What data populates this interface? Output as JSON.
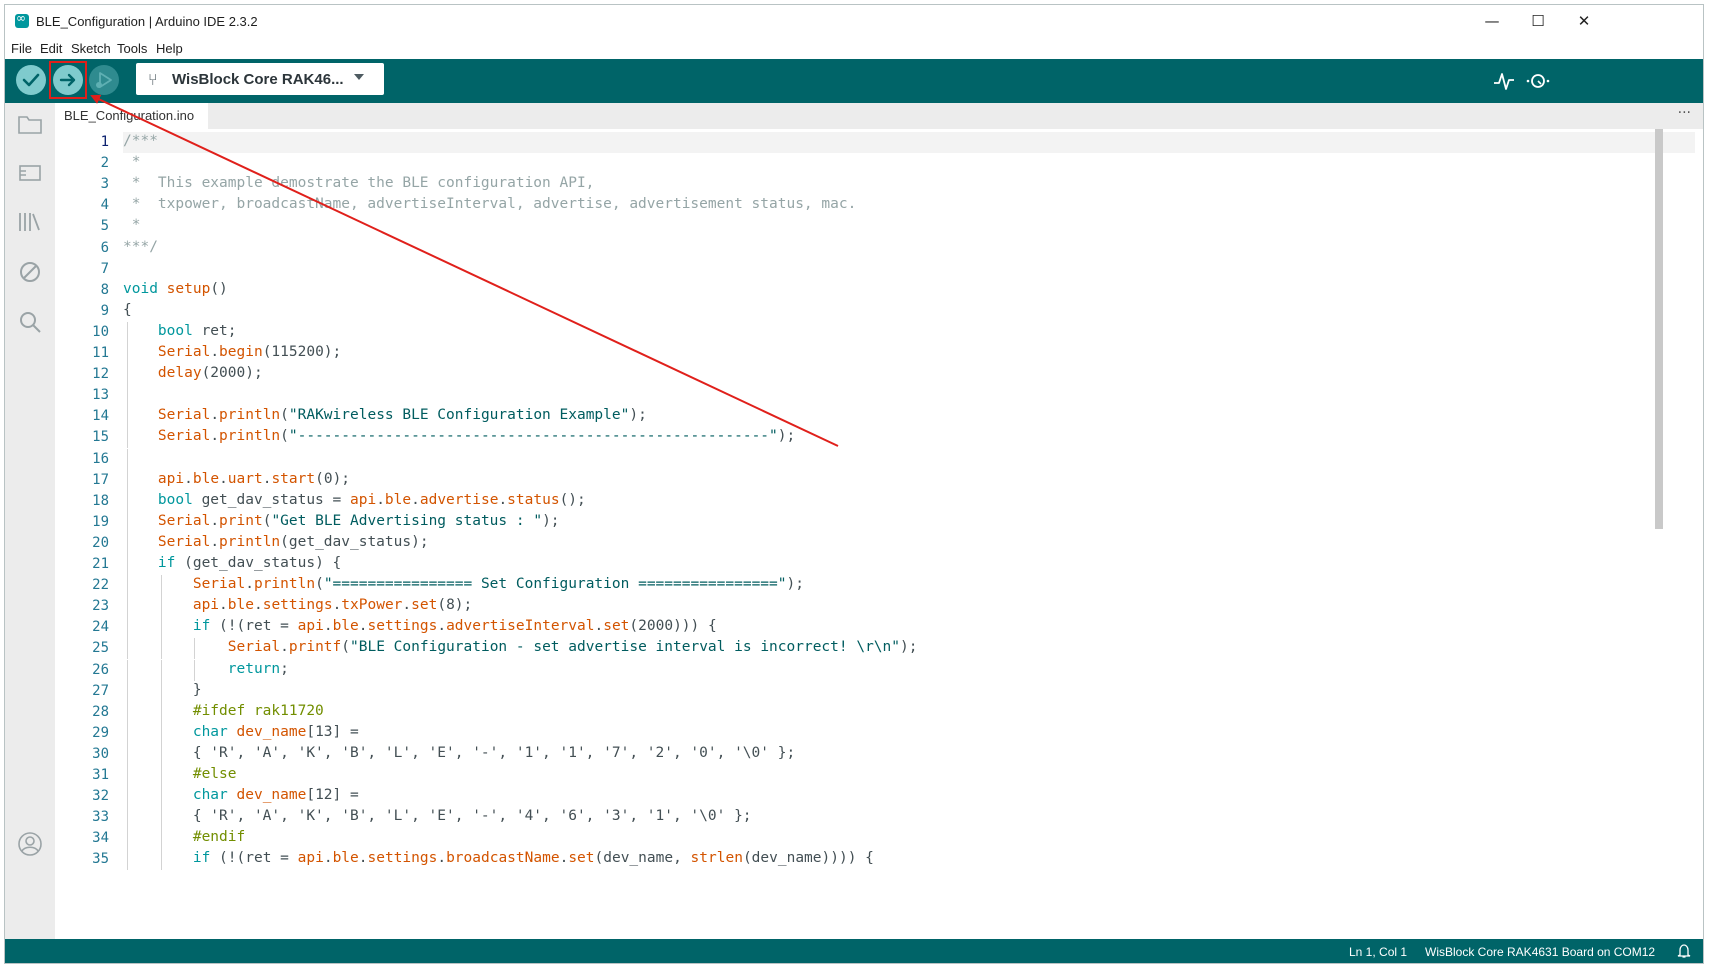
{
  "window": {
    "title": "BLE_Configuration | Arduino IDE 2.3.2"
  },
  "window_controls": {
    "minimize": "—",
    "maximize": "☐",
    "close": "✕"
  },
  "menu": [
    "File",
    "Edit",
    "Sketch",
    "Tools",
    "Help"
  ],
  "toolbar": {
    "verify_icon": "checkmark-icon",
    "upload_icon": "arrow-right-icon",
    "debug_icon": "debug-play-icon",
    "board": "WisBlock Core RAK46...",
    "serial_plotter_icon": "pulse-icon",
    "serial_monitor_icon": "magnifier-dots-icon"
  },
  "sidebar": [
    "folder-icon",
    "boards-icon",
    "library-icon",
    "debug-disabled-icon",
    "search-icon",
    "account-icon"
  ],
  "tab": {
    "label": "BLE_Configuration.ino",
    "more": "···"
  },
  "editor": {
    "active_line": 1,
    "line_numbers": [
      "1",
      "2",
      "3",
      "4",
      "5",
      "6",
      "7",
      "8",
      "9",
      "10",
      "11",
      "12",
      "13",
      "14",
      "15",
      "16",
      "17",
      "18",
      "19",
      "20",
      "21",
      "22",
      "23",
      "24",
      "25",
      "26",
      "27",
      "28",
      "29",
      "30",
      "31",
      "32",
      "33",
      "34",
      "35"
    ],
    "lines": [
      [
        [
          "/***",
          "cm"
        ]
      ],
      [
        [
          " *",
          "cm"
        ]
      ],
      [
        [
          " *  This example demostrate the BLE configuration API,",
          "cm"
        ]
      ],
      [
        [
          " *  txpower, broadcastName, advertiseInterval, advertise, advertisement status, mac.",
          "cm"
        ]
      ],
      [
        [
          " *",
          "cm"
        ]
      ],
      [
        [
          "***/",
          "cm"
        ]
      ],
      [],
      [
        [
          "void",
          "kw"
        ],
        [
          " ",
          "tx"
        ],
        [
          "setup",
          "fn"
        ],
        [
          "()",
          "tx"
        ]
      ],
      [
        [
          "{",
          "tx"
        ]
      ],
      [
        [
          "    ",
          "tx"
        ],
        [
          "bool",
          "kw"
        ],
        [
          " ret;",
          "tx"
        ]
      ],
      [
        [
          "    ",
          "tx"
        ],
        [
          "Serial",
          "fn"
        ],
        [
          ".",
          "tx"
        ],
        [
          "begin",
          "fn"
        ],
        [
          "(115200);",
          "tx"
        ]
      ],
      [
        [
          "    ",
          "tx"
        ],
        [
          "delay",
          "fn"
        ],
        [
          "(2000);",
          "tx"
        ]
      ],
      [],
      [
        [
          "    ",
          "tx"
        ],
        [
          "Serial",
          "fn"
        ],
        [
          ".",
          "tx"
        ],
        [
          "println",
          "fn"
        ],
        [
          "(",
          "tx"
        ],
        [
          "\"RAKwireless BLE Configuration Example\"",
          "st"
        ],
        [
          ");",
          "tx"
        ]
      ],
      [
        [
          "    ",
          "tx"
        ],
        [
          "Serial",
          "fn"
        ],
        [
          ".",
          "tx"
        ],
        [
          "println",
          "fn"
        ],
        [
          "(",
          "tx"
        ],
        [
          "\"------------------------------------------------------\"",
          "st"
        ],
        [
          ");",
          "tx"
        ]
      ],
      [],
      [
        [
          "    ",
          "tx"
        ],
        [
          "api",
          "fn"
        ],
        [
          ".",
          "tx"
        ],
        [
          "ble",
          "fn"
        ],
        [
          ".",
          "tx"
        ],
        [
          "uart",
          "fn"
        ],
        [
          ".",
          "tx"
        ],
        [
          "start",
          "fn"
        ],
        [
          "(0);",
          "tx"
        ]
      ],
      [
        [
          "    ",
          "tx"
        ],
        [
          "bool",
          "kw"
        ],
        [
          " get_dav_status = ",
          "tx"
        ],
        [
          "api",
          "fn"
        ],
        [
          ".",
          "tx"
        ],
        [
          "ble",
          "fn"
        ],
        [
          ".",
          "tx"
        ],
        [
          "advertise",
          "fn"
        ],
        [
          ".",
          "tx"
        ],
        [
          "status",
          "fn"
        ],
        [
          "();",
          "tx"
        ]
      ],
      [
        [
          "    ",
          "tx"
        ],
        [
          "Serial",
          "fn"
        ],
        [
          ".",
          "tx"
        ],
        [
          "print",
          "fn"
        ],
        [
          "(",
          "tx"
        ],
        [
          "\"Get BLE Advertising status : \"",
          "st"
        ],
        [
          ");",
          "tx"
        ]
      ],
      [
        [
          "    ",
          "tx"
        ],
        [
          "Serial",
          "fn"
        ],
        [
          ".",
          "tx"
        ],
        [
          "println",
          "fn"
        ],
        [
          "(get_dav_status);",
          "tx"
        ]
      ],
      [
        [
          "    ",
          "tx"
        ],
        [
          "if",
          "kw"
        ],
        [
          " (get_dav_status) {",
          "tx"
        ]
      ],
      [
        [
          "        ",
          "tx"
        ],
        [
          "Serial",
          "fn"
        ],
        [
          ".",
          "tx"
        ],
        [
          "println",
          "fn"
        ],
        [
          "(",
          "tx"
        ],
        [
          "\"================ Set Configuration ================\"",
          "st"
        ],
        [
          ");",
          "tx"
        ]
      ],
      [
        [
          "        ",
          "tx"
        ],
        [
          "api",
          "fn"
        ],
        [
          ".",
          "tx"
        ],
        [
          "ble",
          "fn"
        ],
        [
          ".",
          "tx"
        ],
        [
          "settings",
          "fn"
        ],
        [
          ".",
          "tx"
        ],
        [
          "txPower",
          "fn"
        ],
        [
          ".",
          "tx"
        ],
        [
          "set",
          "fn"
        ],
        [
          "(8);",
          "tx"
        ]
      ],
      [
        [
          "        ",
          "tx"
        ],
        [
          "if",
          "kw"
        ],
        [
          " (!(ret = ",
          "tx"
        ],
        [
          "api",
          "fn"
        ],
        [
          ".",
          "tx"
        ],
        [
          "ble",
          "fn"
        ],
        [
          ".",
          "tx"
        ],
        [
          "settings",
          "fn"
        ],
        [
          ".",
          "tx"
        ],
        [
          "advertiseInterval",
          "fn"
        ],
        [
          ".",
          "tx"
        ],
        [
          "set",
          "fn"
        ],
        [
          "(2000))) {",
          "tx"
        ]
      ],
      [
        [
          "            ",
          "tx"
        ],
        [
          "Serial",
          "fn"
        ],
        [
          ".",
          "tx"
        ],
        [
          "printf",
          "fn"
        ],
        [
          "(",
          "tx"
        ],
        [
          "\"BLE Configuration - set advertise interval is incorrect! \\r\\n\"",
          "st"
        ],
        [
          ");",
          "tx"
        ]
      ],
      [
        [
          "            ",
          "tx"
        ],
        [
          "return",
          "kw"
        ],
        [
          ";",
          "tx"
        ]
      ],
      [
        [
          "        }",
          "tx"
        ]
      ],
      [
        [
          "        ",
          "tx"
        ],
        [
          "#ifdef rak11720",
          "pp"
        ]
      ],
      [
        [
          "        ",
          "tx"
        ],
        [
          "char",
          "kw"
        ],
        [
          " ",
          "tx"
        ],
        [
          "dev_name",
          "fn"
        ],
        [
          "[13] =",
          "tx"
        ]
      ],
      [
        [
          "        { 'R', 'A', 'K', 'B', 'L', 'E', '-', '1', '1', '7', '2', '0', '\\0' };",
          "tx"
        ]
      ],
      [
        [
          "        ",
          "tx"
        ],
        [
          "#else",
          "pp"
        ]
      ],
      [
        [
          "        ",
          "tx"
        ],
        [
          "char",
          "kw"
        ],
        [
          " ",
          "tx"
        ],
        [
          "dev_name",
          "fn"
        ],
        [
          "[12] =",
          "tx"
        ]
      ],
      [
        [
          "        { 'R', 'A', 'K', 'B', 'L', 'E', '-', '4', '6', '3', '1', '\\0' };",
          "tx"
        ]
      ],
      [
        [
          "        ",
          "tx"
        ],
        [
          "#endif",
          "pp"
        ]
      ],
      [
        [
          "        ",
          "tx"
        ],
        [
          "if",
          "kw"
        ],
        [
          " (!(ret = ",
          "tx"
        ],
        [
          "api",
          "fn"
        ],
        [
          ".",
          "tx"
        ],
        [
          "ble",
          "fn"
        ],
        [
          ".",
          "tx"
        ],
        [
          "settings",
          "fn"
        ],
        [
          ".",
          "tx"
        ],
        [
          "broadcastName",
          "fn"
        ],
        [
          ".",
          "tx"
        ],
        [
          "set",
          "fn"
        ],
        [
          "(dev_name, ",
          "tx"
        ],
        [
          "strlen",
          "fn"
        ],
        [
          "(dev_name)))) {",
          "tx"
        ]
      ]
    ]
  },
  "statusbar": {
    "position": "Ln 1, Col 1",
    "board": "WisBlock Core RAK4631 Board on COM12",
    "bell_icon": "bell-icon"
  },
  "colors": {
    "toolbar": "#006468",
    "accent_light": "#7fcbcd",
    "comment": "#95a5a6",
    "keyword": "#00979d",
    "function": "#d35400",
    "string": "#005c5f",
    "preprocessor": "#728e00",
    "text": "#434f54",
    "line_number": "#237893",
    "annotation": "#e0201b"
  }
}
